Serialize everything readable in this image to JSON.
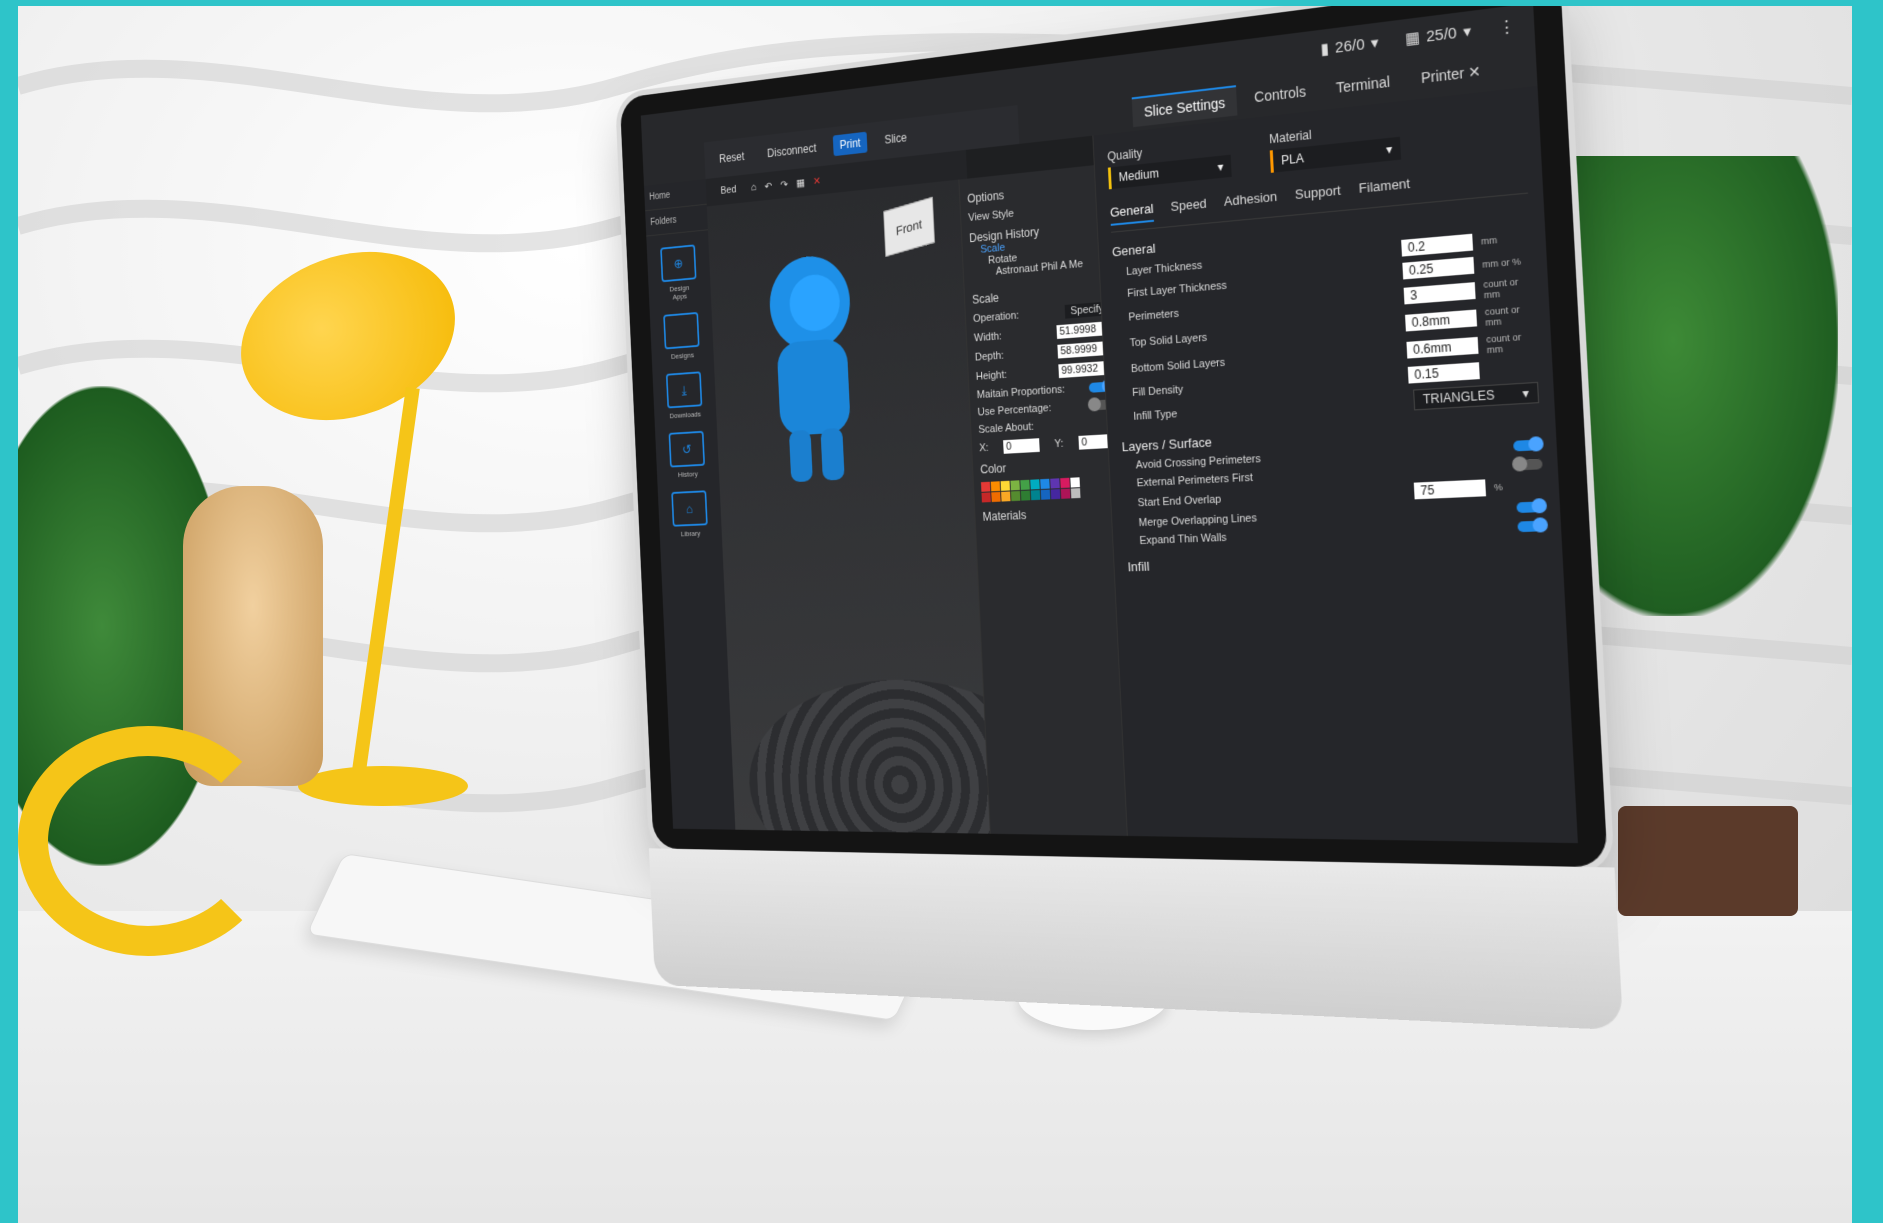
{
  "status": {
    "left_counter": "26/0",
    "right_counter": "25/0"
  },
  "top_tabs": [
    "Slice Settings",
    "Controls",
    "Terminal",
    "Printer"
  ],
  "left_nav": {
    "home": "Home",
    "folders": "Folders",
    "items": [
      "Design Apps",
      "Designs",
      "Downloads",
      "History",
      "Library"
    ]
  },
  "toolbar": {
    "reset": "Reset",
    "disconnect": "Disconnect",
    "print": "Print",
    "slice": "Slice",
    "bed": "Bed"
  },
  "viewport": {
    "cube_label": "Front"
  },
  "options_panel": {
    "options": "Options",
    "view_style": "View Style",
    "design_history": "Design History",
    "history_items": [
      "Scale",
      "Rotate",
      "Astronaut Phil A Me"
    ]
  },
  "scale_panel": {
    "title": "Scale",
    "operation_label": "Operation:",
    "operation_value": "Specify",
    "width_label": "Width:",
    "width_value": "51.9998",
    "depth_label": "Depth:",
    "depth_value": "58.9999",
    "height_label": "Height:",
    "height_value": "99.9932",
    "maintain_label": "Maitain Proportions:",
    "percentage_label": "Use Percentage:",
    "scale_about_label": "Scale About:",
    "x_label": "X:",
    "x_value": "0",
    "y_label": "Y:",
    "y_value": "0",
    "color_label": "Color",
    "materials_label": "Materials"
  },
  "slice_settings": {
    "quality_label": "Quality",
    "quality_value": "Medium",
    "material_label": "Material",
    "material_value": "PLA",
    "tabs": [
      "General",
      "Speed",
      "Adhesion",
      "Support",
      "Filament"
    ],
    "general_group": "General",
    "rows": [
      {
        "label": "Layer Thickness",
        "value": "0.2",
        "unit": "mm"
      },
      {
        "label": "First Layer Thickness",
        "value": "0.25",
        "unit": "mm or %"
      },
      {
        "label": "Perimeters",
        "value": "3",
        "unit": "count or mm"
      },
      {
        "label": "Top Solid Layers",
        "value": "0.8mm",
        "unit": "count or mm"
      },
      {
        "label": "Bottom Solid Layers",
        "value": "0.6mm",
        "unit": "count or mm"
      },
      {
        "label": "Fill Density",
        "value": "0.15",
        "unit": ""
      }
    ],
    "infill_type_label": "Infill Type",
    "infill_type_value": "TRIANGLES",
    "layers_group": "Layers / Surface",
    "avoid_crossing": "Avoid Crossing Perimeters",
    "external_first": "External Perimeters First",
    "start_end_overlap": "Start End Overlap",
    "start_end_value": "75",
    "start_end_unit": "%",
    "merge_overlapping": "Merge Overlapping Lines",
    "expand_thin": "Expand Thin Walls",
    "infill_group": "Infill"
  }
}
